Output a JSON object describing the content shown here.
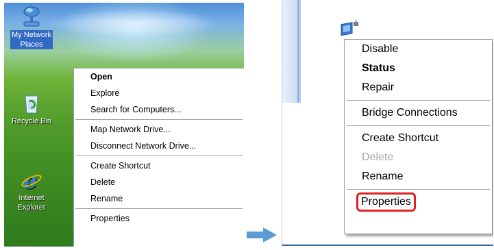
{
  "desktop": {
    "icons": [
      {
        "label_line1": "My Network",
        "label_line2": "Places",
        "icon": "network-places-icon"
      },
      {
        "label_line1": "Recycle Bin",
        "label_line2": "",
        "icon": "recycle-bin-icon"
      },
      {
        "label_line1": "Internet",
        "label_line2": "Explorer",
        "icon": "internet-explorer-icon"
      }
    ],
    "context_menu": {
      "items": [
        "Open",
        "Explore",
        "Search for Computers...",
        "Map Network Drive...",
        "Disconnect Network Drive...",
        "Create Shortcut",
        "Delete",
        "Rename",
        "Properties"
      ]
    }
  },
  "connection": {
    "context_menu": {
      "items": [
        "Disable",
        "Status",
        "Repair",
        "Bridge Connections",
        "Create Shortcut",
        "Delete",
        "Rename",
        "Properties"
      ]
    },
    "highlight_color": "#e02020"
  },
  "colors": {
    "selection": "#316ac5",
    "arrow": "#5b9bd5"
  }
}
